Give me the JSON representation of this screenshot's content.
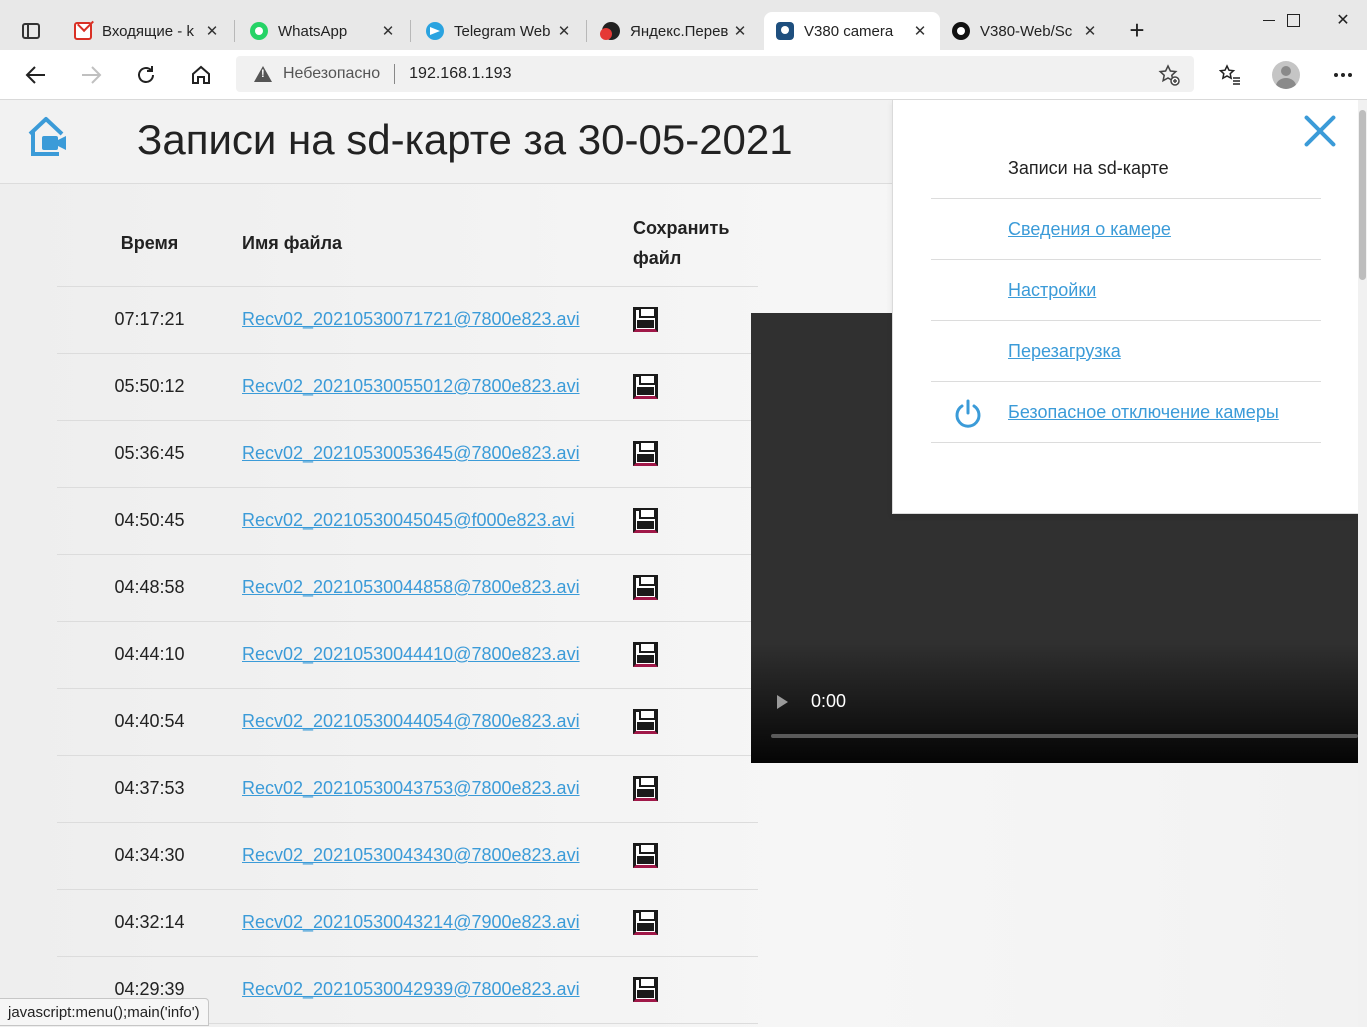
{
  "browser": {
    "tabs": [
      {
        "label": "Входящие - k",
        "icon": "gmail-icon",
        "active": false
      },
      {
        "label": "WhatsApp",
        "icon": "whatsapp-icon",
        "active": false
      },
      {
        "label": "Telegram Web",
        "icon": "telegram-icon",
        "active": false
      },
      {
        "label": "Яндекс.Перев",
        "icon": "yandex-translate-icon",
        "active": false
      },
      {
        "label": "V380 camera",
        "icon": "v380-icon",
        "active": true
      },
      {
        "label": "V380-Web/Sc",
        "icon": "github-icon",
        "active": false
      }
    ],
    "close_glyph": "✕",
    "new_tab_glyph": "+",
    "address": {
      "security_label": "Небезопасно",
      "url": "192.168.1.193"
    },
    "status_text": "javascript:menu();main('info')"
  },
  "page": {
    "title": "Записи на sd-карте за 30-05-2021",
    "table": {
      "headers": {
        "time": "Время",
        "file": "Имя файла",
        "save": "Сохранить файл"
      },
      "rows": [
        {
          "time": "07:17:21",
          "file": "Recv02_20210530071721@7800e823.avi"
        },
        {
          "time": "05:50:12",
          "file": "Recv02_20210530055012@7800e823.avi"
        },
        {
          "time": "05:36:45",
          "file": "Recv02_20210530053645@7800e823.avi"
        },
        {
          "time": "04:50:45",
          "file": "Recv02_20210530045045@f000e823.avi"
        },
        {
          "time": "04:48:58",
          "file": "Recv02_20210530044858@7800e823.avi"
        },
        {
          "time": "04:44:10",
          "file": "Recv02_20210530044410@7800e823.avi"
        },
        {
          "time": "04:40:54",
          "file": "Recv02_20210530044054@7800e823.avi"
        },
        {
          "time": "04:37:53",
          "file": "Recv02_20210530043753@7800e823.avi"
        },
        {
          "time": "04:34:30",
          "file": "Recv02_20210530043430@7800e823.avi"
        },
        {
          "time": "04:32:14",
          "file": "Recv02_20210530043214@7900e823.avi"
        },
        {
          "time": "04:29:39",
          "file": "Recv02_20210530042939@7800e823.avi"
        }
      ]
    },
    "video": {
      "time": "0:00",
      "progress": 0
    },
    "menu": {
      "items": [
        {
          "label": "Записи на sd-карте",
          "current": true,
          "icon": ""
        },
        {
          "label": "Сведения о камере",
          "current": false,
          "icon": ""
        },
        {
          "label": "Настройки",
          "current": false,
          "icon": ""
        },
        {
          "label": "Перезагрузка",
          "current": false,
          "icon": ""
        },
        {
          "label": "Безопасное отключение камеры",
          "current": false,
          "icon": "power-icon"
        }
      ]
    }
  },
  "colors": {
    "accent": "#3b9bd8",
    "video_bg": "#303030",
    "save_icon_accent": "#a01848"
  }
}
